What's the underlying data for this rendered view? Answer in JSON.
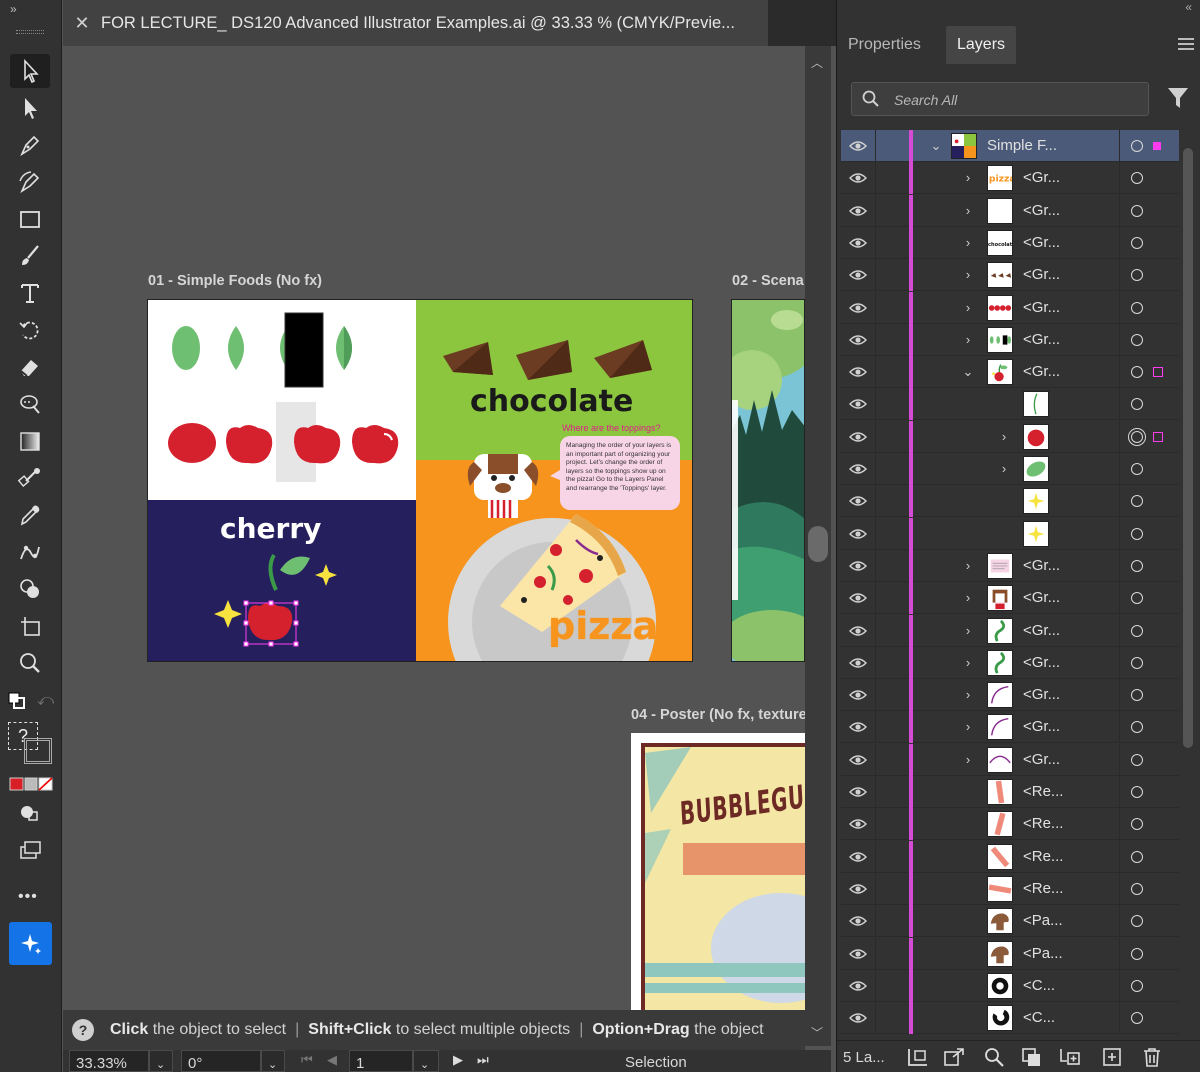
{
  "toolbar": {
    "collapse": "»",
    "tools": [
      "selection-tool",
      "direct-selection-tool",
      "pen-tool",
      "curvature-tool",
      "rectangle-tool",
      "paintbrush-tool",
      "type-tool",
      "rotate-tool",
      "eraser-tool",
      "warp-tool",
      "gradient-tool",
      "blend-tool",
      "eyedropper-tool",
      "puppet-warp-tool",
      "shape-builder-tool",
      "artboard-tool",
      "zoom-tool"
    ],
    "help_glyph": "?",
    "more": "•••"
  },
  "document": {
    "close": "✕",
    "title": "FOR LECTURE_ DS120 Advanced Illustrator Examples.ai @ 33.33 % (CMYK/Previe..."
  },
  "artboards": {
    "ab1_label": "01 - Simple Foods (No fx)",
    "ab2_label": "02 - Scena",
    "ab4_label": "04 - Poster (No fx, texture",
    "chocolate_text": "chocolate",
    "toppings_question": "Where are the toppings?",
    "bubble_text": "Managing the order of your layers is an important part of organizing your project. Let's change the order of layers so the toppings show up on the pizza! Go to the Layers Panel and rearrange the 'Toppings' layer.",
    "cherry_text": "cherry",
    "pizza_text": "pizza",
    "poster_text": "BUBBLEGUM"
  },
  "statusbar": {
    "help": "?",
    "click": "Click",
    "click_rest": "the object to select",
    "shift": "Shift+Click",
    "shift_rest": "to select multiple objects",
    "option": "Option+Drag",
    "option_rest": "the object"
  },
  "bottombar": {
    "zoom": "33.33%",
    "rotation": "0°",
    "artboard": "1",
    "mode": "Selection"
  },
  "panel": {
    "tab_properties": "Properties",
    "tab_layers": "Layers",
    "search_placeholder": "Search All",
    "footer_count": "5 La...",
    "layers": [
      {
        "name": "Simple F...",
        "selected": true,
        "twirl": "open",
        "indent": 0,
        "thumb": "simplefoods"
      },
      {
        "name": "<Gr...",
        "twirl": "closed",
        "indent": 1,
        "thumb": "pizza"
      },
      {
        "name": "<Gr...",
        "twirl": "closed",
        "indent": 1,
        "thumb": "blank"
      },
      {
        "name": "<Gr...",
        "twirl": "closed",
        "indent": 1,
        "thumb": "chocolate"
      },
      {
        "name": "<Gr...",
        "twirl": "closed",
        "indent": 1,
        "thumb": "chocbits"
      },
      {
        "name": "<Gr...",
        "twirl": "closed",
        "indent": 1,
        "thumb": "cherries"
      },
      {
        "name": "<Gr...",
        "twirl": "closed",
        "indent": 1,
        "thumb": "leaves"
      },
      {
        "name": "<Gr...",
        "twirl": "open",
        "indent": 1,
        "thumb": "cherry",
        "selsq": true
      },
      {
        "name": "",
        "twirl": "none",
        "indent": 2,
        "thumb": "stem"
      },
      {
        "name": "",
        "twirl": "closed",
        "indent": 2,
        "thumb": "redcherry",
        "selsq": true,
        "target": "double"
      },
      {
        "name": "",
        "twirl": "closed",
        "indent": 2,
        "thumb": "leaf"
      },
      {
        "name": "",
        "twirl": "none",
        "indent": 2,
        "thumb": "star"
      },
      {
        "name": "",
        "twirl": "none",
        "indent": 2,
        "thumb": "star"
      },
      {
        "name": "<Gr...",
        "twirl": "closed",
        "indent": 1,
        "thumb": "text"
      },
      {
        "name": "<Gr...",
        "twirl": "closed",
        "indent": 1,
        "thumb": "dog"
      },
      {
        "name": "<Gr...",
        "twirl": "closed",
        "indent": 1,
        "thumb": "pepper"
      },
      {
        "name": "<Gr...",
        "twirl": "closed",
        "indent": 1,
        "thumb": "pepper"
      },
      {
        "name": "<Gr...",
        "twirl": "closed",
        "indent": 1,
        "thumb": "arc"
      },
      {
        "name": "<Gr...",
        "twirl": "closed",
        "indent": 1,
        "thumb": "arc"
      },
      {
        "name": "<Gr...",
        "twirl": "closed",
        "indent": 1,
        "thumb": "arc2"
      },
      {
        "name": "<Re...",
        "twirl": "none",
        "indent": 1,
        "thumb": "rect1"
      },
      {
        "name": "<Re...",
        "twirl": "none",
        "indent": 1,
        "thumb": "rect2"
      },
      {
        "name": "<Re...",
        "twirl": "none",
        "indent": 1,
        "thumb": "rect3"
      },
      {
        "name": "<Re...",
        "twirl": "none",
        "indent": 1,
        "thumb": "rect4"
      },
      {
        "name": "<Pa...",
        "twirl": "none",
        "indent": 1,
        "thumb": "mushroom"
      },
      {
        "name": "<Pa...",
        "twirl": "none",
        "indent": 1,
        "thumb": "mushroom"
      },
      {
        "name": "<C...",
        "twirl": "none",
        "indent": 1,
        "thumb": "olive"
      },
      {
        "name": "<C...",
        "twirl": "none",
        "indent": 1,
        "thumb": "olive2"
      }
    ]
  },
  "colors": {
    "layer_color": "#d64bd6",
    "selection": "#ff3cf0",
    "accent": "#1473e6"
  }
}
